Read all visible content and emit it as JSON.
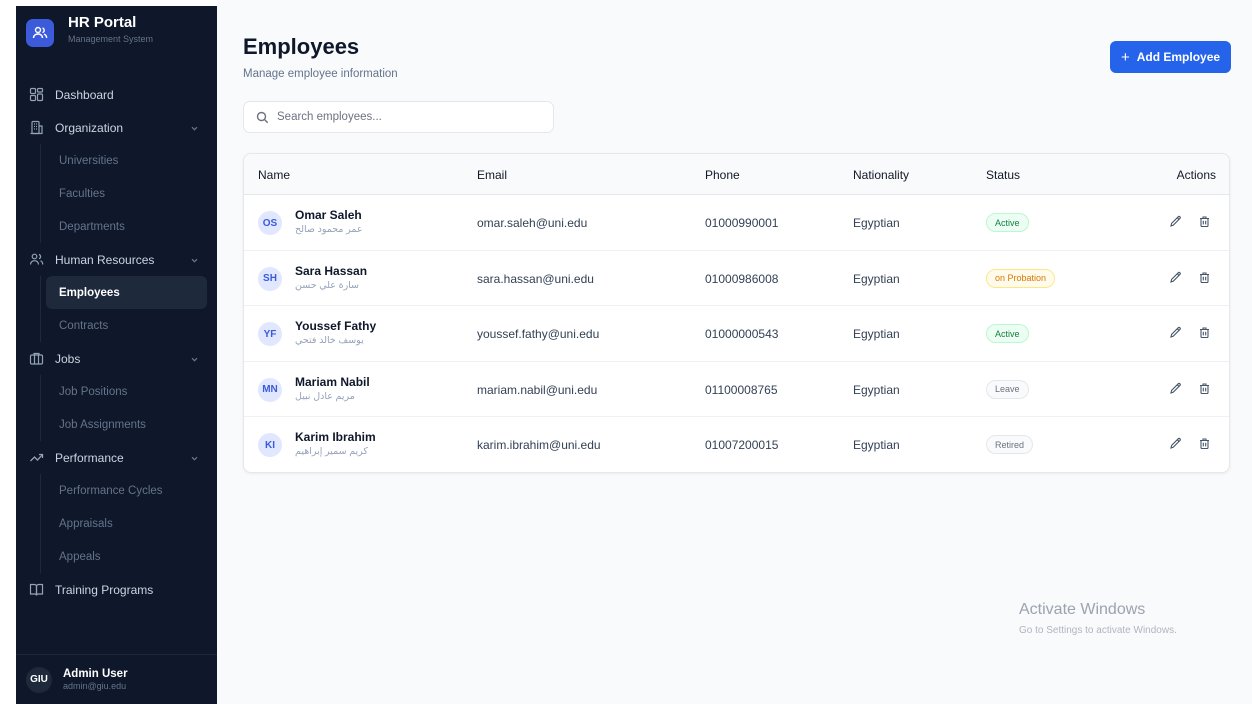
{
  "app": {
    "title": "HR Portal",
    "subtitle": "Management System"
  },
  "sidebar": {
    "items": [
      {
        "type": "item",
        "label": "Dashboard",
        "icon": "grid-icon"
      },
      {
        "type": "item",
        "label": "Organization",
        "icon": "building-icon",
        "expandable": true
      },
      {
        "type": "sub",
        "label": "Universities"
      },
      {
        "type": "sub",
        "label": "Faculties"
      },
      {
        "type": "sub",
        "label": "Departments"
      },
      {
        "type": "item",
        "label": "Human Resources",
        "icon": "users-icon",
        "expandable": true
      },
      {
        "type": "sub",
        "label": "Employees",
        "active": true
      },
      {
        "type": "sub",
        "label": "Contracts"
      },
      {
        "type": "item",
        "label": "Jobs",
        "icon": "briefcase-icon",
        "expandable": true
      },
      {
        "type": "sub",
        "label": "Job Positions"
      },
      {
        "type": "sub",
        "label": "Job Assignments"
      },
      {
        "type": "item",
        "label": "Performance",
        "icon": "trending-icon",
        "expandable": true
      },
      {
        "type": "sub",
        "label": "Performance Cycles"
      },
      {
        "type": "sub",
        "label": "Appraisals"
      },
      {
        "type": "sub",
        "label": "Appeals"
      },
      {
        "type": "item",
        "label": "Training Programs",
        "icon": "book-icon"
      }
    ],
    "user": {
      "initials": "GIU",
      "name": "Admin User",
      "email": "admin@giu.edu"
    }
  },
  "page": {
    "title": "Employees",
    "subtitle": "Manage employee information",
    "add_button": "Add Employee",
    "search_placeholder": "Search employees..."
  },
  "table": {
    "columns": [
      "Name",
      "Email",
      "Phone",
      "Nationality",
      "Status",
      "Actions"
    ],
    "rows": [
      {
        "initials": "OS",
        "name": "Omar Saleh",
        "name_ar": "عمر محمود صالح",
        "email": "omar.saleh@uni.edu",
        "phone": "01000990001",
        "nationality": "Egyptian",
        "status": "Active",
        "status_kind": "active"
      },
      {
        "initials": "SH",
        "name": "Sara Hassan",
        "name_ar": "سارة علي حسن",
        "email": "sara.hassan@uni.edu",
        "phone": "01000986008",
        "nationality": "Egyptian",
        "status": "on Probation",
        "status_kind": "probation"
      },
      {
        "initials": "YF",
        "name": "Youssef Fathy",
        "name_ar": "يوسف خالد فتحي",
        "email": "youssef.fathy@uni.edu",
        "phone": "01000000543",
        "nationality": "Egyptian",
        "status": "Active",
        "status_kind": "active"
      },
      {
        "initials": "MN",
        "name": "Mariam Nabil",
        "name_ar": "مريم عادل نبيل",
        "email": "mariam.nabil@uni.edu",
        "phone": "01100008765",
        "nationality": "Egyptian",
        "status": "Leave",
        "status_kind": "neutral"
      },
      {
        "initials": "KI",
        "name": "Karim Ibrahim",
        "name_ar": "كريم سمير إبراهيم",
        "email": "karim.ibrahim@uni.edu",
        "phone": "01007200015",
        "nationality": "Egyptian",
        "status": "Retired",
        "status_kind": "neutral"
      }
    ]
  },
  "status_colors": {
    "active": {
      "bg": "#ecfdf3",
      "fg": "#15803d",
      "border": "#bbf7d0"
    },
    "probation": {
      "bg": "#fffbeb",
      "fg": "#d97706",
      "border": "#fde68a"
    },
    "neutral": {
      "bg": "#f9fafb",
      "fg": "#6b7280",
      "border": "#e5e7eb"
    }
  },
  "watermark": {
    "title": "Activate Windows",
    "subtitle": "Go to Settings to activate Windows."
  },
  "colors": {
    "sidebar_bg": "#0f172a",
    "accent": "#2563eb"
  }
}
